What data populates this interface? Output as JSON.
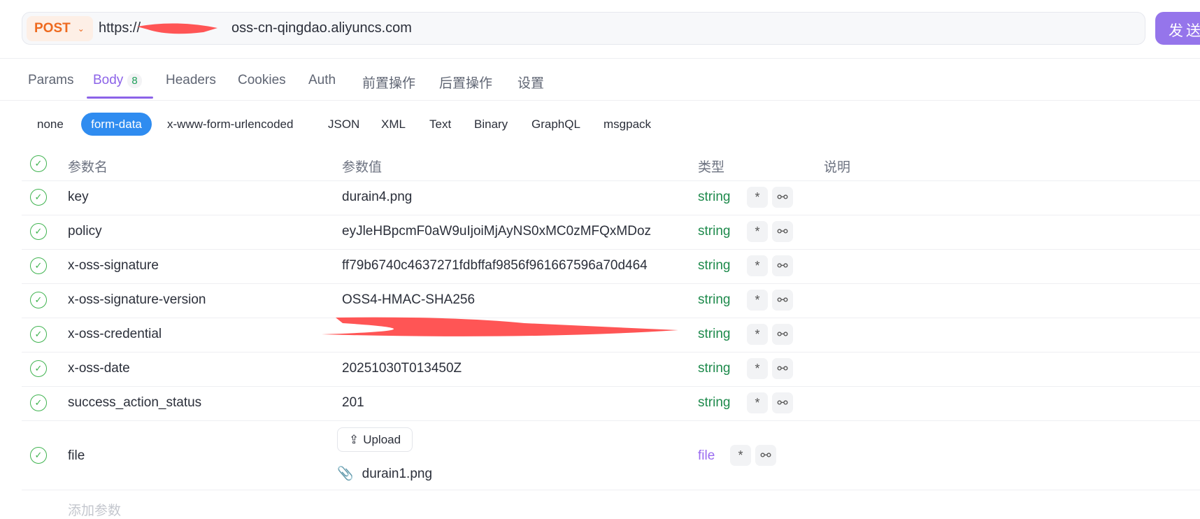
{
  "request": {
    "method": "POST",
    "url_prefix": "https://",
    "url_suffix": "oss-cn-qingdao.aliyuncs.com",
    "send_label": "发送"
  },
  "tabs": [
    {
      "label": "Params"
    },
    {
      "label": "Body",
      "badge": "8"
    },
    {
      "label": "Headers"
    },
    {
      "label": "Cookies"
    },
    {
      "label": "Auth"
    },
    {
      "label": "前置操作"
    },
    {
      "label": "后置操作"
    },
    {
      "label": "设置"
    }
  ],
  "body_types": [
    "none",
    "form-data",
    "x-www-form-urlencoded",
    "JSON",
    "XML",
    "Text",
    "Binary",
    "GraphQL",
    "msgpack"
  ],
  "table": {
    "headers": {
      "name": "参数名",
      "value": "参数值",
      "type": "类型",
      "desc": "说明"
    },
    "rows": [
      {
        "name": "key",
        "value": "durain4.png",
        "type": "string"
      },
      {
        "name": "policy",
        "value": "eyJleHBpcmF0aW9uIjoiMjAyNS0xMC0zMFQxMDoz",
        "type": "string"
      },
      {
        "name": "x-oss-signature",
        "value": "ff79b6740c4637271fdbffaf9856f961667596a70d464",
        "type": "string"
      },
      {
        "name": "x-oss-signature-version",
        "value": "OSS4-HMAC-SHA256",
        "type": "string"
      },
      {
        "name": "x-oss-credential",
        "value": "",
        "type": "string"
      },
      {
        "name": "x-oss-date",
        "value": "20251030T013450Z",
        "type": "string"
      },
      {
        "name": "success_action_status",
        "value": "201",
        "type": "string"
      }
    ],
    "file_row": {
      "name": "file",
      "upload_label": "Upload",
      "file_name": "durain1.png",
      "type": "file"
    },
    "add_placeholder": "添加参数"
  },
  "colors": {
    "accent": "#8c63e8",
    "string": "#1e8a4c",
    "method": "#ee6a1f",
    "pill": "#2f8cf0"
  }
}
